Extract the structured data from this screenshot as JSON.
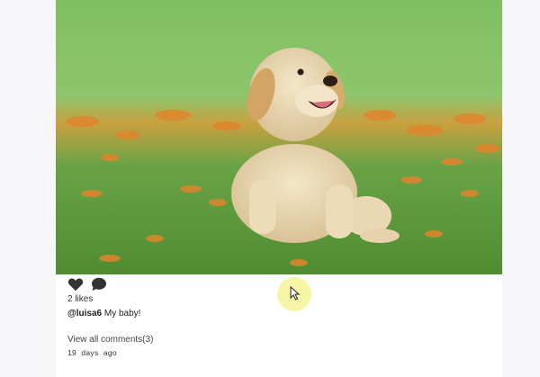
{
  "post": {
    "image_description_icon": "puppy-photo",
    "likes_text": "2 likes",
    "username": "@luisa6",
    "caption": "My baby!",
    "view_comments": "View all comments(3)",
    "timestamp": "19  days  ago"
  },
  "icons": {
    "like": "heart-icon",
    "comment": "comment-icon",
    "cursor": "mouse-pointer-icon"
  },
  "colors": {
    "icon": "#333333",
    "cursor_highlight": "#f5f596"
  }
}
